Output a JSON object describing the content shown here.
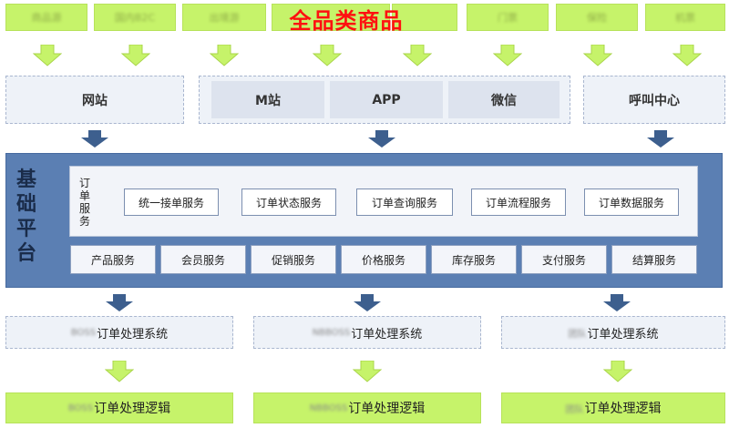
{
  "title": "全品类商品",
  "categories": [
    "商品源",
    "国内B2C",
    "出境游",
    "",
    "门票",
    "保险",
    "机票"
  ],
  "channels": {
    "website": "网站",
    "mobile_site": "M站",
    "app": "APP",
    "wechat": "微信",
    "call_center": "呼叫中心"
  },
  "platform": {
    "label": "基础平台",
    "order_services_label": "订单服务",
    "order_services": [
      "统一接单服务",
      "订单状态服务",
      "订单查询服务",
      "订单流程服务",
      "订单数据服务"
    ],
    "services": [
      "产品服务",
      "会员服务",
      "促销服务",
      "价格服务",
      "库存服务",
      "支付服务",
      "结算服务"
    ]
  },
  "order_systems": [
    {
      "blurred_prefix": "BOSS",
      "label": "订单处理系统"
    },
    {
      "blurred_prefix": "NBBOSS",
      "label": "订单处理系统"
    },
    {
      "blurred_prefix": "团队",
      "label": "订单处理系统"
    }
  ],
  "order_logic": [
    {
      "blurred_prefix": "BOSS",
      "label": "订单处理逻辑"
    },
    {
      "blurred_prefix": "NBBOSS",
      "label": "订单处理逻辑"
    },
    {
      "blurred_prefix": "团队",
      "label": "订单处理逻辑"
    }
  ],
  "colors": {
    "green_box": "#c6f36a",
    "platform_blue": "#5b7fb3",
    "arrow_blue": "#3d5f8e",
    "title_red": "#ff1010"
  }
}
